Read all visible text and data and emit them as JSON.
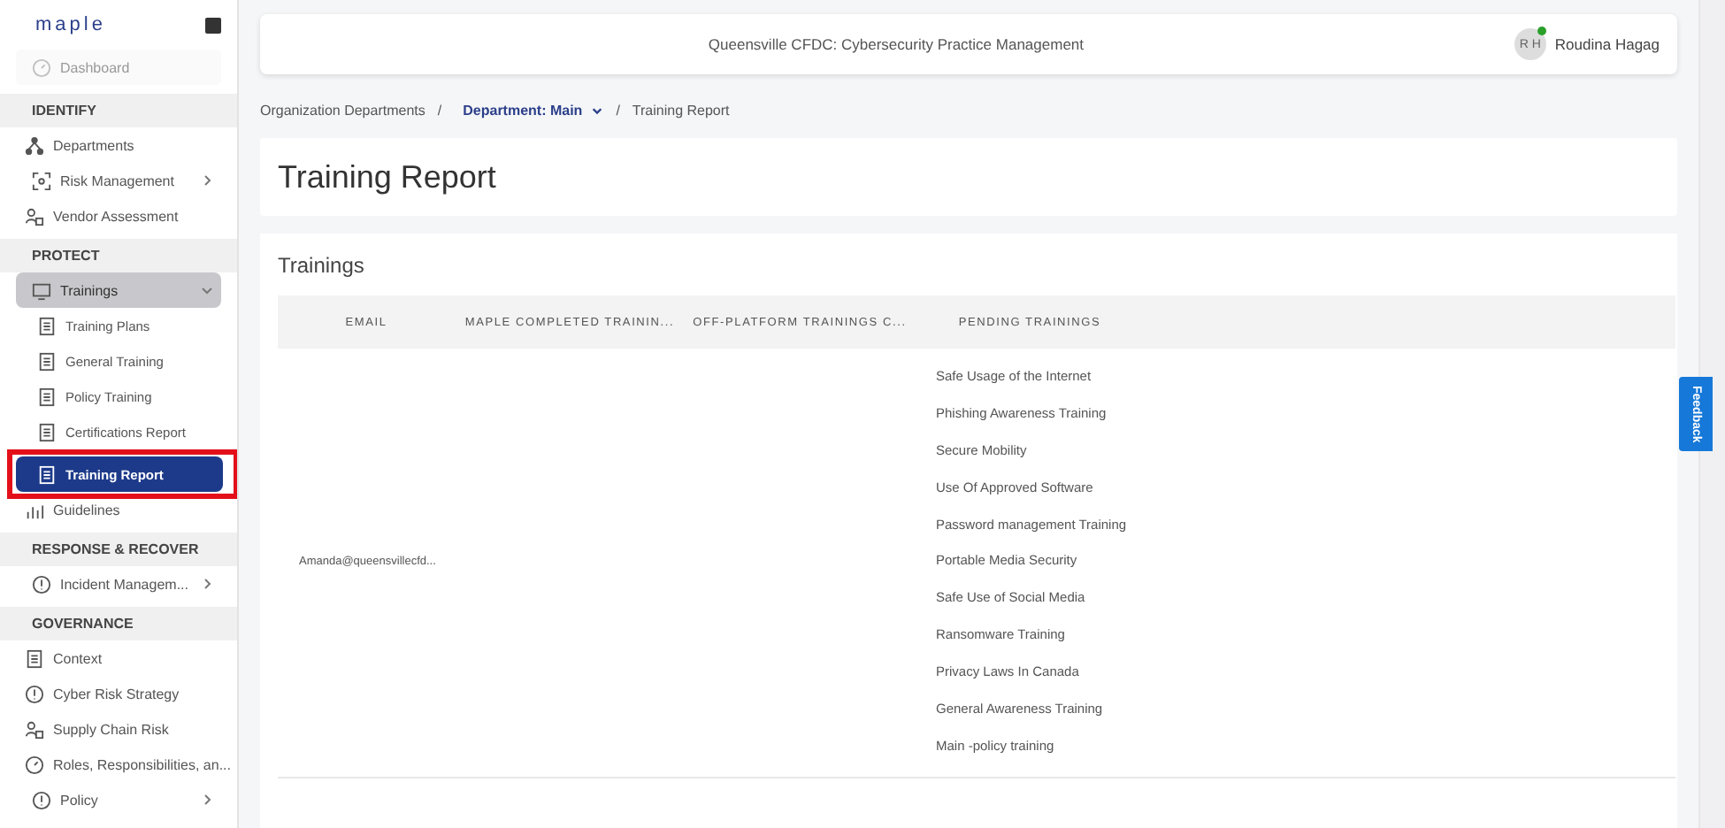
{
  "sidebar": {
    "logo": "maple",
    "items": [
      {
        "kind": "link",
        "label": "Dashboard",
        "disabled": true,
        "selected": false
      },
      {
        "kind": "section",
        "label": "IDENTIFY"
      },
      {
        "kind": "link",
        "label": "Departments",
        "disabled": false,
        "selected": false
      },
      {
        "kind": "group",
        "label": "Risk Management",
        "expanded": false,
        "selected": false
      },
      {
        "kind": "link",
        "label": "Vendor Assessment",
        "disabled": false,
        "selected": false
      },
      {
        "kind": "section",
        "label": "PROTECT"
      },
      {
        "kind": "group",
        "label": "Trainings",
        "expanded": true,
        "selected": true,
        "children": [
          {
            "label": "Training Plans",
            "selected": false,
            "highlighted": false
          },
          {
            "label": "General Training",
            "selected": false,
            "highlighted": false
          },
          {
            "label": "Policy Training",
            "selected": false,
            "highlighted": false
          },
          {
            "label": "Certifications Report",
            "selected": false,
            "highlighted": false
          },
          {
            "label": "Training Report",
            "selected": true,
            "highlighted": true
          }
        ]
      },
      {
        "kind": "link",
        "label": "Guidelines",
        "disabled": false,
        "selected": false
      },
      {
        "kind": "section",
        "label": "RESPONSE & RECOVER"
      },
      {
        "kind": "group",
        "label": "Incident Managem...",
        "expanded": false,
        "selected": false
      },
      {
        "kind": "section",
        "label": "GOVERNANCE"
      },
      {
        "kind": "link",
        "label": "Context",
        "disabled": false,
        "selected": false
      },
      {
        "kind": "link",
        "label": "Cyber Risk Strategy",
        "disabled": false,
        "selected": false
      },
      {
        "kind": "link",
        "label": "Supply Chain Risk",
        "disabled": false,
        "selected": false
      },
      {
        "kind": "link",
        "label": "Roles, Responsibilities, an...",
        "disabled": false,
        "selected": false
      },
      {
        "kind": "group",
        "label": "Policy",
        "expanded": false,
        "selected": false
      }
    ]
  },
  "header": {
    "title": "Queensville CFDC: Cybersecurity Practice Management",
    "user": {
      "initials": "R H",
      "name": "Roudina Hagag",
      "online": true
    }
  },
  "breadcrumb": [
    {
      "kind": "link",
      "label": "Organization Departments"
    },
    {
      "kind": "separator",
      "label": "/"
    },
    {
      "kind": "dropdown",
      "label": "Department: Main"
    },
    {
      "kind": "separator",
      "label": "/"
    },
    {
      "kind": "current",
      "label": "Training Report"
    }
  ],
  "page_title": "Training Report",
  "card": {
    "title": "Trainings",
    "table": {
      "columns": [
        "EMAIL",
        "MAPLE COMPLETED TRAININ...",
        "OFF-PLATFORM TRAININGS C...",
        "PENDING TRAININGS"
      ],
      "rows": [
        {
          "email": "Amanda@queensvillecfd...",
          "pending_trainings": [
            "Safe Usage of the Internet",
            "Phishing Awareness Training",
            "Secure Mobility",
            "Use Of Approved Software",
            "Password management Training",
            "Portable Media Security",
            "Safe Use of Social Media",
            "Ransomware Training",
            "Privacy Laws In Canada",
            "General Awareness Training",
            "Main -policy training"
          ]
        }
      ]
    }
  },
  "feedback_button": "Feedback"
}
